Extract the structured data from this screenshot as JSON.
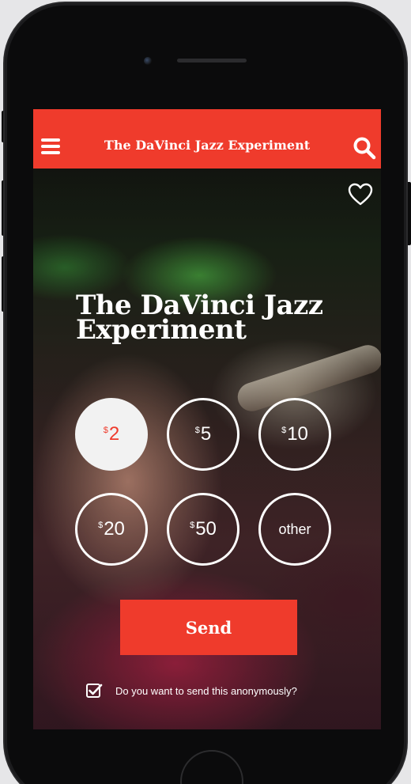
{
  "header": {
    "title": "The DaVinci Jazz Experiment"
  },
  "artist": {
    "name_line1": "The DaVinci Jazz",
    "name_line2": "Experiment"
  },
  "tip_amounts": [
    {
      "currency": "$",
      "value": "2",
      "selected": true
    },
    {
      "currency": "$",
      "value": "5",
      "selected": false
    },
    {
      "currency": "$",
      "value": "10",
      "selected": false
    },
    {
      "currency": "$",
      "value": "20",
      "selected": false
    },
    {
      "currency": "$",
      "value": "50",
      "selected": false
    },
    {
      "currency": "",
      "value": "other",
      "selected": false
    }
  ],
  "send_button": {
    "label": "Send"
  },
  "anonymous": {
    "label": "Do you want to send this anonymously?",
    "checked": true
  },
  "colors": {
    "accent": "#ef3b2c",
    "text": "#ffffff",
    "selected_bg": "#f2f2f2"
  },
  "icons": {
    "menu": "hamburger-menu-icon",
    "search": "search-icon",
    "favorite": "heart-icon",
    "checkbox": "checkbox-checked-icon"
  }
}
